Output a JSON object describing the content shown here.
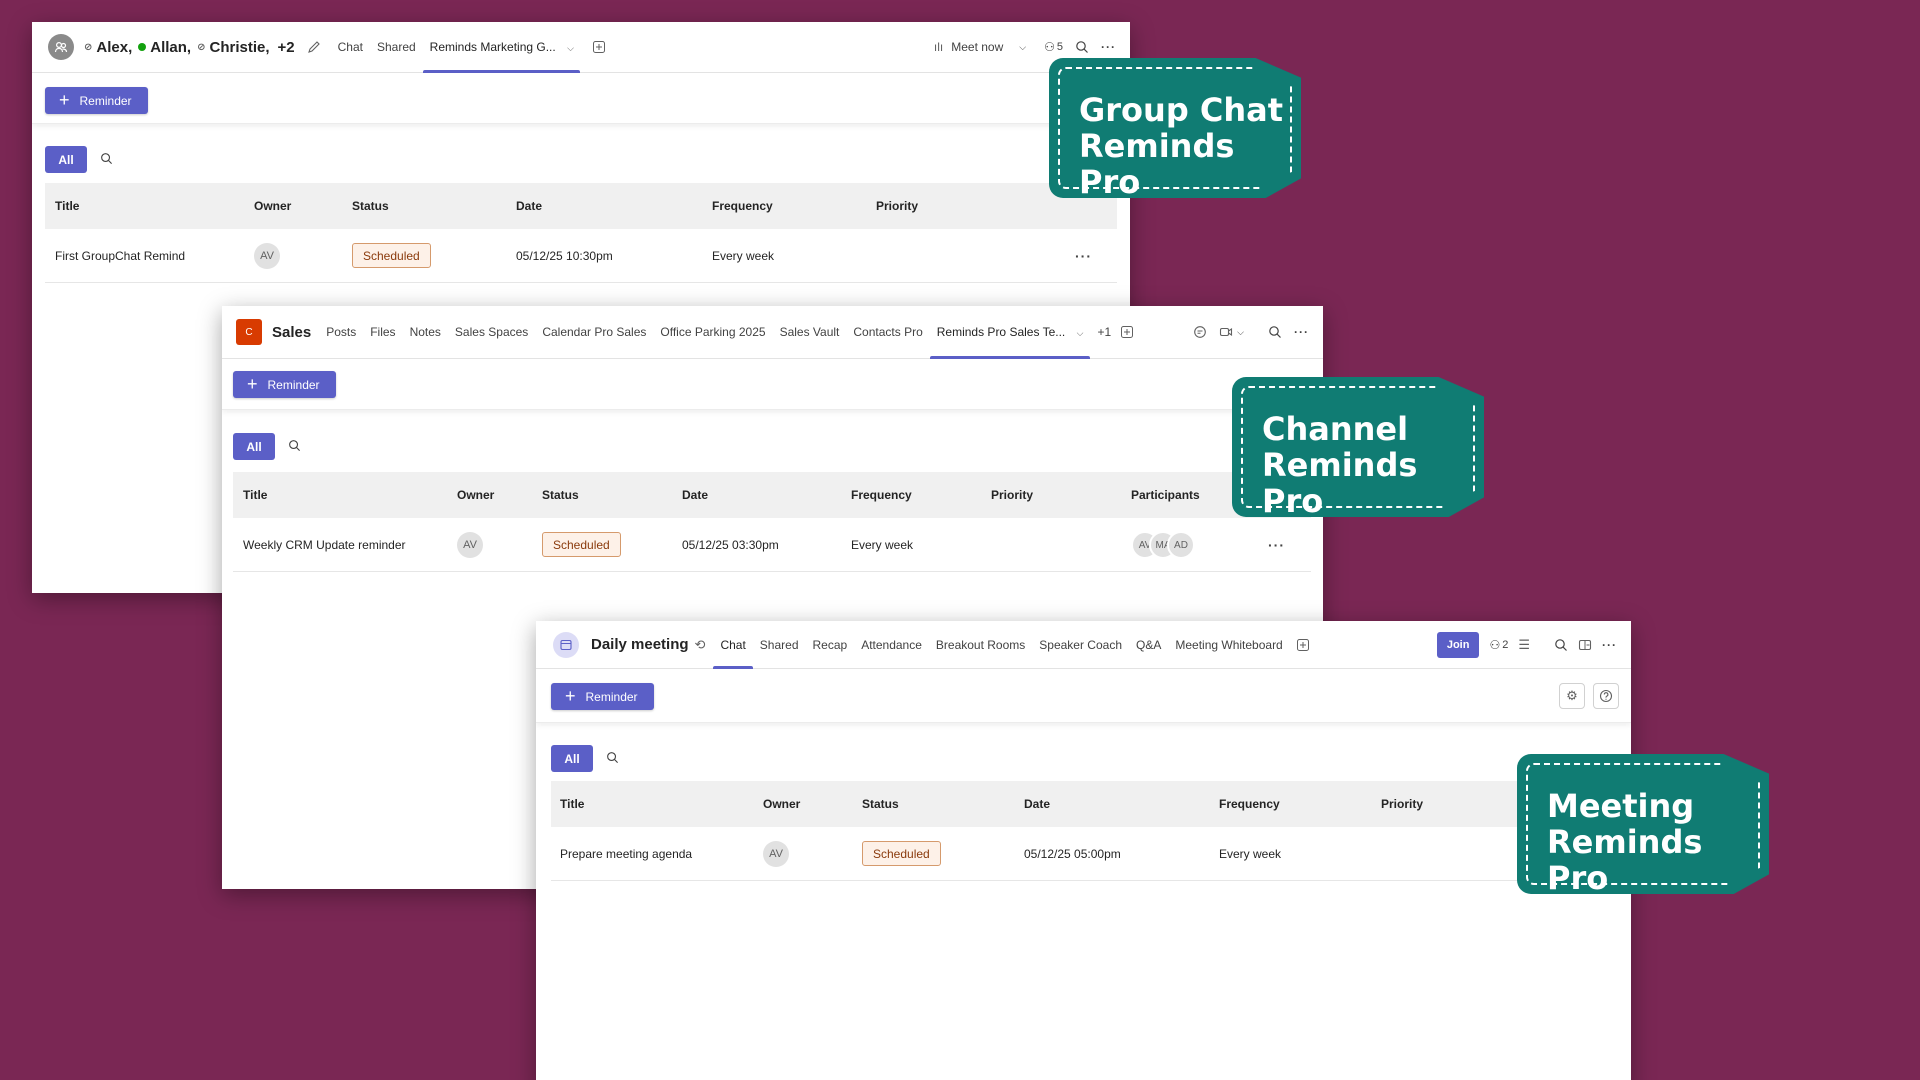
{
  "group_chat": {
    "participants": [
      "Alex,",
      "Allan,",
      "Christie,"
    ],
    "extra": "+2",
    "tabs": [
      "Chat",
      "Shared",
      "Reminds Marketing G..."
    ],
    "meet_now": "Meet now",
    "people_count": "5",
    "add_button": "Reminder",
    "filter_all": "All",
    "columns": [
      "Title",
      "Owner",
      "Status",
      "Date",
      "Frequency",
      "Priority"
    ],
    "rows": [
      {
        "title": "First GroupChat Remind",
        "owner": "AV",
        "status": "Scheduled",
        "date": "05/12/25 10:30pm",
        "frequency": "Every week",
        "priority": ""
      }
    ]
  },
  "channel": {
    "team_initial": "C",
    "team_name": "Sales",
    "tabs": [
      "Posts",
      "Files",
      "Notes",
      "Sales Spaces",
      "Calendar Pro Sales",
      "Office Parking 2025",
      "Sales Vault",
      "Contacts Pro",
      "Reminds Pro Sales Te..."
    ],
    "more_tabs": "+1",
    "add_button": "Reminder",
    "filter_all": "All",
    "columns": [
      "Title",
      "Owner",
      "Status",
      "Date",
      "Frequency",
      "Priority",
      "Participants"
    ],
    "rows": [
      {
        "title": "Weekly CRM Update reminder",
        "owner": "AV",
        "status": "Scheduled",
        "date": "05/12/25 03:30pm",
        "frequency": "Every week",
        "priority": "",
        "participants": [
          "AV",
          "MA",
          "AD"
        ]
      }
    ]
  },
  "meeting": {
    "title": "Daily meeting",
    "tabs": [
      "Chat",
      "Shared",
      "Recap",
      "Attendance",
      "Breakout Rooms",
      "Speaker Coach",
      "Q&A",
      "Meeting Whiteboard"
    ],
    "join": "Join",
    "people_count": "2",
    "add_button": "Reminder",
    "filter_all": "All",
    "columns": [
      "Title",
      "Owner",
      "Status",
      "Date",
      "Frequency",
      "Priority"
    ],
    "rows": [
      {
        "title": "Prepare meeting agenda",
        "owner": "AV",
        "status": "Scheduled",
        "date": "05/12/25 05:00pm",
        "frequency": "Every week",
        "priority": ""
      }
    ]
  },
  "callouts": {
    "group_chat": [
      "Group Chat",
      "Reminds Pro"
    ],
    "channel": [
      "Channel",
      "Reminds Pro"
    ],
    "meeting": [
      "Meeting",
      "Reminds Pro"
    ]
  },
  "colors": {
    "background": "#7a2754",
    "accent": "#5b5fc7",
    "callout": "#107c73",
    "scheduled_border": "#d59a6c"
  }
}
